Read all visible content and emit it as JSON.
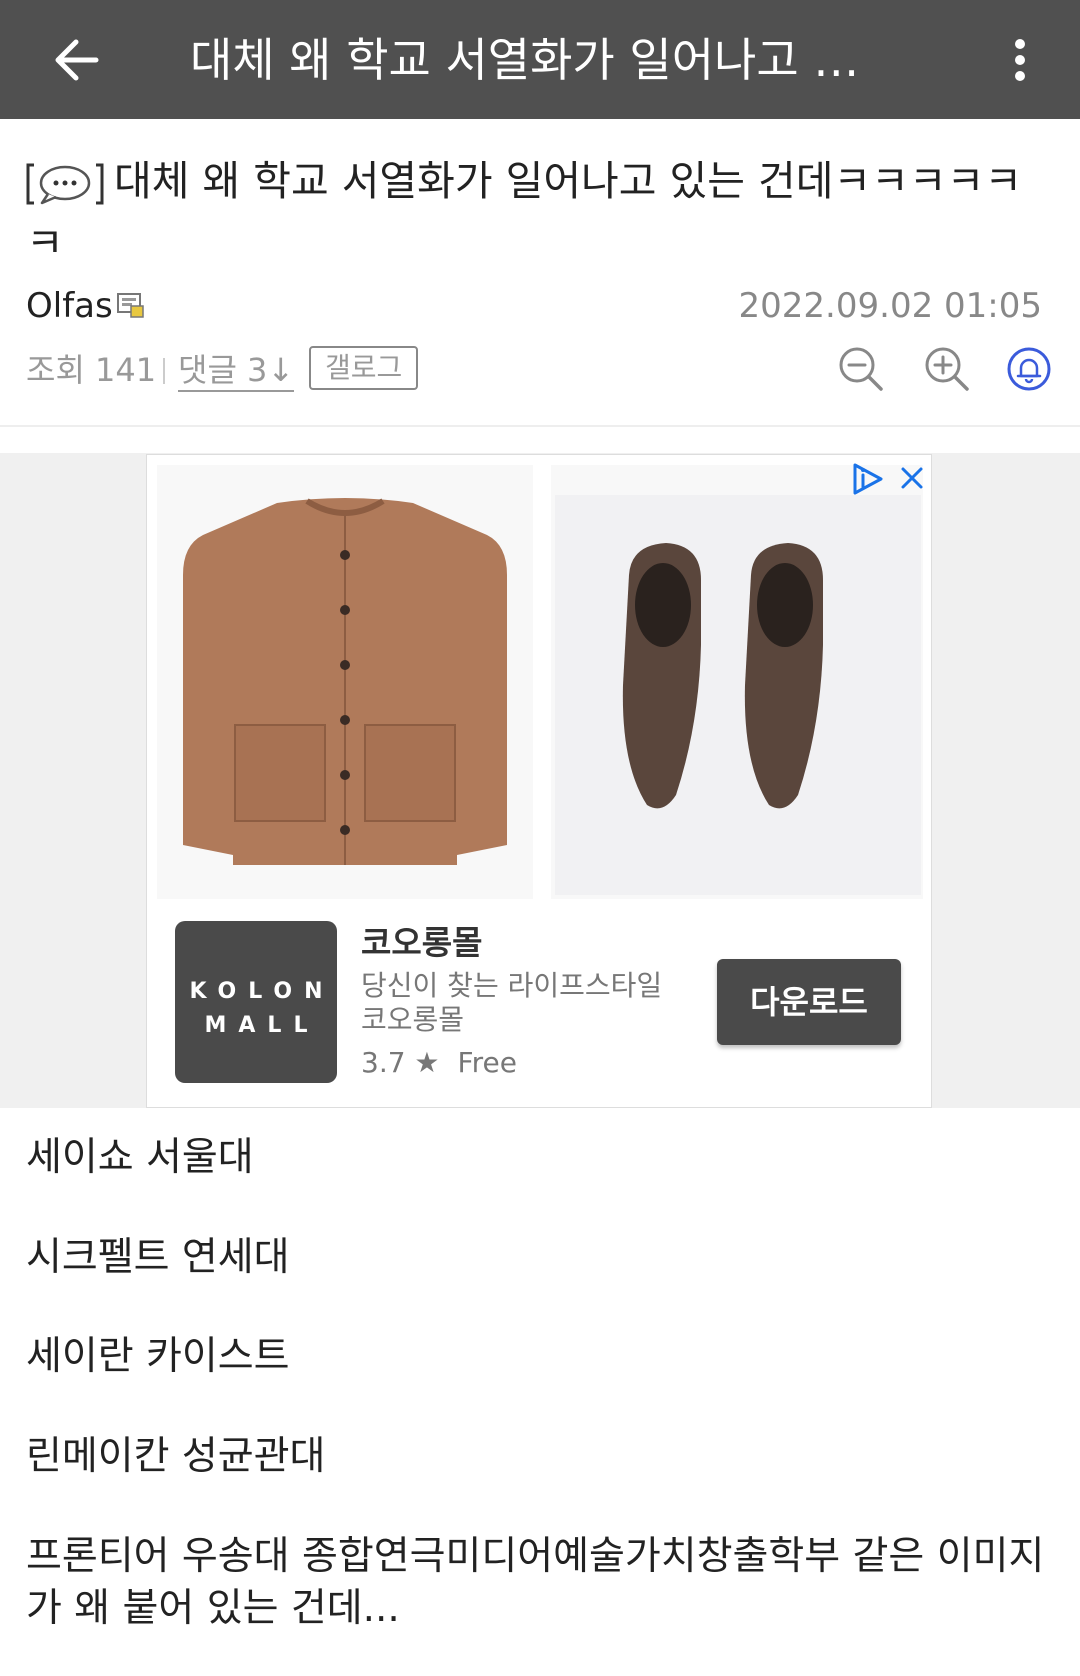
{
  "appbar": {
    "title": "대체 왜 학교 서열화가 일어나고 있는 건데ㅋㅋㅋㅋㅋㅋ",
    "back_icon": "arrow-left-icon",
    "more_icon": "more-vertical-icon"
  },
  "post": {
    "badge_icon": "speech-bubble-icon",
    "title": "대체 왜 학교 서열화가 일어나고 있는 건데ㅋㅋㅋㅋㅋㅋ",
    "author": "Olfas",
    "author_icon": "fixed-nick-icon",
    "date": "2022.09.02 01:05",
    "views": "조회 141",
    "comments": "댓글 3↓",
    "gallog": "갤로그",
    "icons": [
      "zoom-out-icon",
      "zoom-in-icon",
      "bell-icon"
    ]
  },
  "ad": {
    "brand_logo_line1": "KOLON",
    "brand_logo_line2": "MALL",
    "app_name": "코오롱몰",
    "description": "당신이 찾는 라이프스타일 코오롱몰",
    "rating": "3.7 ★",
    "price": "Free",
    "button_label": "다운로드",
    "choices_icon": "ad-choices-icon",
    "close_icon": "close-icon",
    "product_images": [
      "cardigan-image",
      "suede-shoes-image"
    ]
  },
  "body": {
    "lines": [
      "세이쇼 서울대",
      "시크펠트 연세대",
      "세이란 카이스트",
      "린메이칸 성균관대",
      "프론티어 우송대 종합연극미디어예술가치창출학부 같은 이미지가 왜 붙어 있는 건데..."
    ]
  },
  "colors": {
    "appbar_bg": "#505050",
    "ad_accent": "#1a73e8",
    "bell_accent": "#3b5bdb"
  }
}
